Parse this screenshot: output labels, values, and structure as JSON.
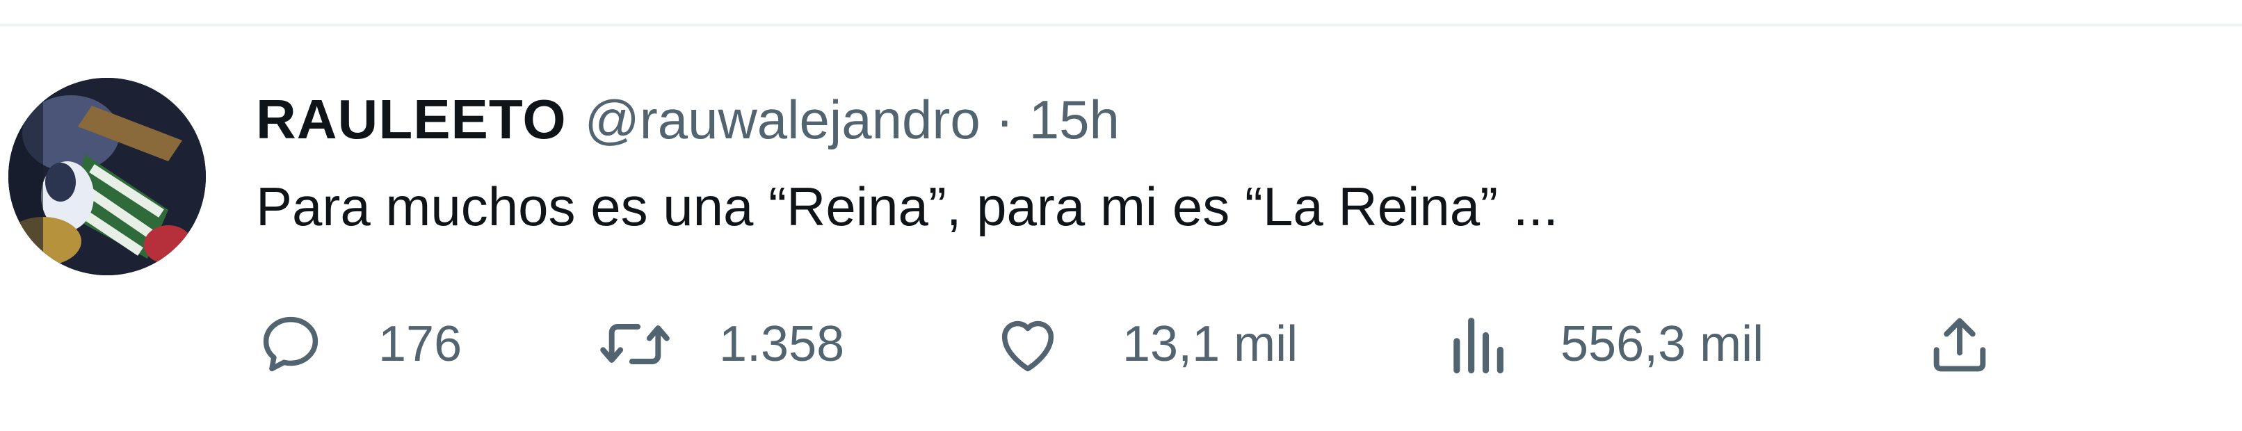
{
  "tweet": {
    "display_name": "RAULEETO",
    "handle": "@rauwalejandro",
    "separator": "·",
    "time": "15h",
    "text": "Para muchos es una “Reina”, para mi es “La Reina” ...",
    "actions": {
      "replies": "176",
      "retweets": "1.358",
      "likes": "13,1 mil",
      "views": "556,3 mil"
    }
  },
  "icons": {
    "reply": "reply-icon",
    "retweet": "retweet-icon",
    "like": "heart-icon",
    "views": "views-icon",
    "share": "share-icon"
  },
  "colors": {
    "text": "#0f1419",
    "secondary": "#536471",
    "divider": "#eff3f4"
  }
}
